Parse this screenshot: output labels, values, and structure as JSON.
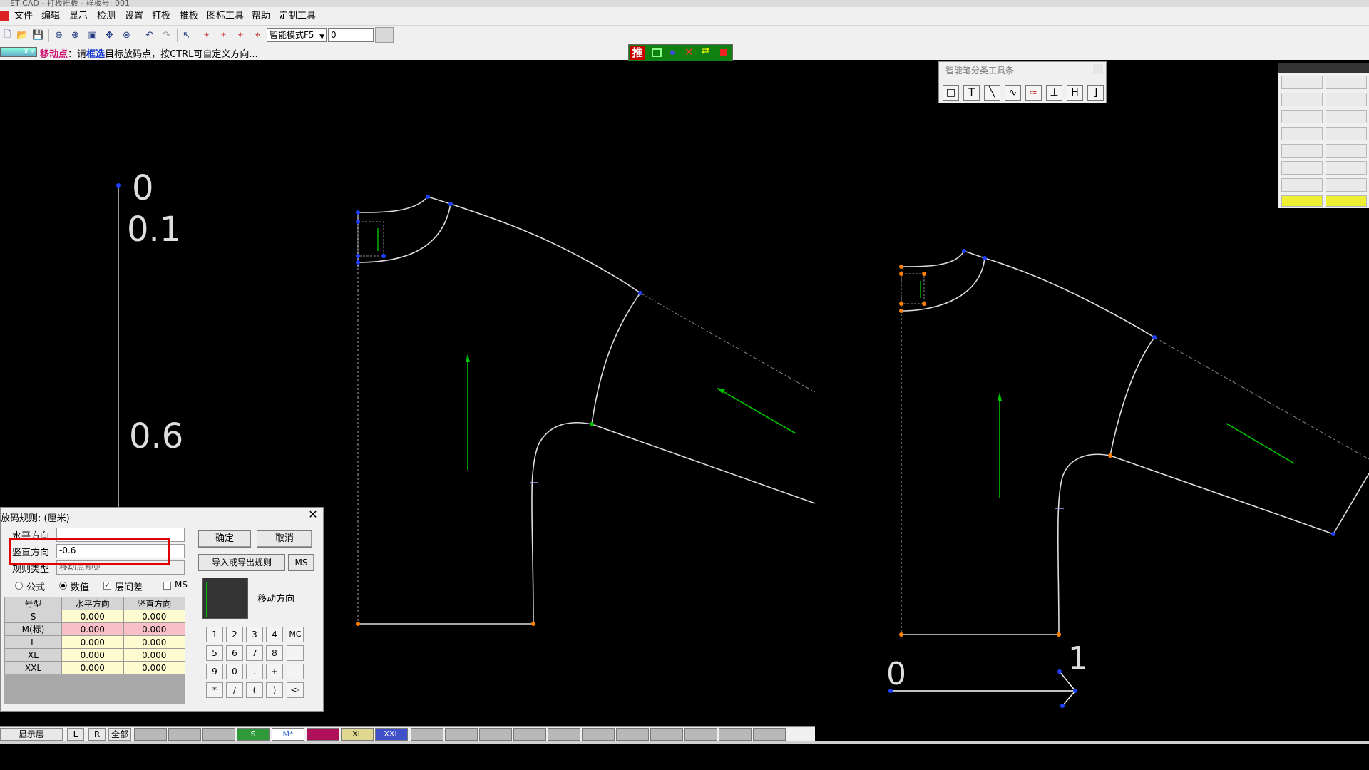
{
  "window": {
    "title": "ET CAD - 打板推板 - 样板号: 001"
  },
  "menu": [
    {
      "label": "文件",
      "name": "menu-file"
    },
    {
      "label": "编辑",
      "name": "menu-edit"
    },
    {
      "label": "显示",
      "name": "menu-view"
    },
    {
      "label": "检测",
      "name": "menu-check"
    },
    {
      "label": "设置",
      "name": "menu-settings"
    },
    {
      "label": "打板",
      "name": "menu-pattern"
    },
    {
      "label": "推板",
      "name": "menu-grading"
    },
    {
      "label": "图标工具",
      "name": "menu-icon-tools"
    },
    {
      "label": "帮助",
      "name": "menu-help"
    },
    {
      "label": "定制工具",
      "name": "menu-custom-tools"
    }
  ],
  "toolbar": {
    "mode_value": "智能模式F5",
    "input_value": "0",
    "icons": [
      "new-file-icon",
      "open-folder-icon",
      "save-icon",
      "zoom-out-icon",
      "zoom-in-icon",
      "zoom-fit-icon",
      "pan-icon",
      "zoom-window-icon",
      "undo-icon",
      "redo-icon",
      "select-arrow-icon",
      "grade-point-icon",
      "grade-copy-icon",
      "grade-align-icon",
      "grade-rule-icon"
    ]
  },
  "status": {
    "mini": "X Y",
    "mode": "移动点",
    "sep": "：",
    "prefix": "请",
    "keyword": "框选",
    "rest": "目标放码点，按CTRL可自定义方向..."
  },
  "status_tools": {
    "push_label": "推"
  },
  "smart_toolbar": {
    "title": "智能笔分类工具条",
    "buttons": [
      {
        "name": "rectangle-tool-icon",
        "glyph": "□"
      },
      {
        "name": "text-tool-icon",
        "glyph": "T"
      },
      {
        "name": "line-tool-icon",
        "glyph": "╲"
      },
      {
        "name": "curve-tool-icon",
        "glyph": "∿"
      },
      {
        "name": "wave-tool-icon",
        "glyph": "≈"
      },
      {
        "name": "perpendicular-tool-icon",
        "glyph": "⊥"
      },
      {
        "name": "measure-tool-icon",
        "glyph": "H"
      },
      {
        "name": "corner-tool-icon",
        "glyph": "⌋"
      }
    ]
  },
  "canvas": {
    "scale_vertical": {
      "labels": [
        "0",
        "0.1",
        "0.6"
      ]
    },
    "scale_horizontal": {
      "labels": [
        "0",
        "1"
      ]
    }
  },
  "dialog": {
    "title": "放码规则: (厘米)",
    "horizontal_label": "水平方向",
    "horizontal_value": "",
    "vertical_label": "竖直方向",
    "vertical_value": "-0.6",
    "rule_type_label": "规则类型",
    "rule_type_value": "移动点规则",
    "ok_label": "确定",
    "cancel_label": "取消",
    "import_export_label": "导入或导出规则",
    "ms_label": "MS",
    "options": {
      "formula": "公式",
      "numeric": "数值",
      "layer_diff": "层间差",
      "ms": "MS"
    },
    "move_direction_label": "移动方向",
    "table": {
      "headers": [
        "号型",
        "水平方向",
        "竖直方向"
      ],
      "rows": [
        {
          "size": "S",
          "h": "0.000",
          "v": "0.000"
        },
        {
          "size": "M(标)",
          "h": "0.000",
          "v": "0.000"
        },
        {
          "size": "L",
          "h": "0.000",
          "v": "0.000"
        },
        {
          "size": "XL",
          "h": "0.000",
          "v": "0.000"
        },
        {
          "size": "XXL",
          "h": "0.000",
          "v": "0.000"
        }
      ]
    },
    "keypad": [
      "1",
      "2",
      "3",
      "4",
      "MC",
      "5",
      "6",
      "7",
      "8",
      "",
      "9",
      "0",
      ".",
      "+",
      "-",
      "*",
      "/",
      "(",
      ")",
      "<-"
    ]
  },
  "layerbar": {
    "display_label": "显示层",
    "l_label": "L",
    "r_label": "R",
    "all_label": "全部",
    "sizes": [
      {
        "label": "S",
        "color": "#2e9a3a"
      },
      {
        "label": "M*",
        "color": "#ffffff"
      },
      {
        "label": "",
        "color": "#b0105a"
      },
      {
        "label": "XL",
        "color": "#e0d890"
      },
      {
        "label": "XXL",
        "color": "#4050c8"
      }
    ]
  }
}
